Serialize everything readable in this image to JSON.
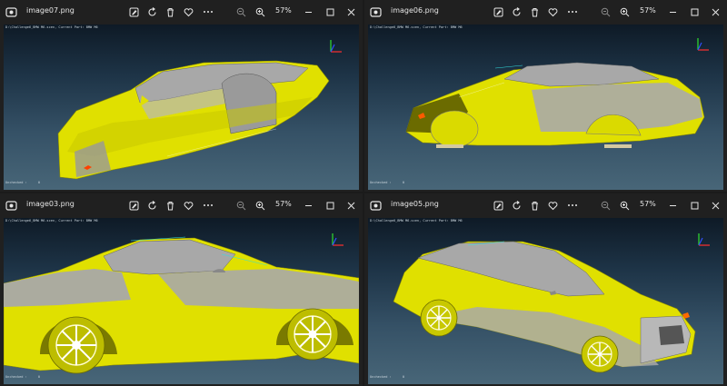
{
  "windows": [
    {
      "id": "tl",
      "filename": "image07.png",
      "zoom": "57%",
      "viewport_header": "D:\\Challenge6_BMW M6.scen, Current Part: BMW M6",
      "viewport_footer": {
        "label": "Unchecked :",
        "value": "0"
      }
    },
    {
      "id": "tr",
      "filename": "image06.png",
      "zoom": "57%",
      "viewport_header": "D:\\Challenge6_BMW M6.scen, Current Part: BMW M6",
      "viewport_footer": {
        "label": "Unchecked :",
        "value": "0"
      }
    },
    {
      "id": "bl",
      "filename": "image03.png",
      "zoom": "57%",
      "viewport_header": "D:\\Challenge6_BMW M6.scen, Current Part: BMW M6",
      "viewport_footer": {
        "label": "Unchecked :",
        "value": "0"
      }
    },
    {
      "id": "br",
      "filename": "image05.png",
      "zoom": "57%",
      "viewport_header": "D:\\Challenge6_BMW M6.scen, Current Part: BMW M6",
      "viewport_footer": {
        "label": "Unchecked :",
        "value": "0"
      }
    }
  ],
  "toolbar_icons": [
    "edit-image-icon",
    "rotate-icon",
    "delete-icon",
    "favorite-heart-icon",
    "more-options-icon",
    "zoom-out-icon",
    "zoom-in-icon"
  ],
  "window_controls": [
    "minimize-icon",
    "maximize-icon",
    "close-icon"
  ],
  "colors": {
    "titlebar": "#202020",
    "car_body": "#e0e000",
    "car_gray": "#a8a8a8",
    "viewport_top": "#0e1a26",
    "viewport_bottom": "#486678",
    "axis_x": "#ff3030",
    "axis_y": "#30e030",
    "axis_z": "#3050ff"
  }
}
